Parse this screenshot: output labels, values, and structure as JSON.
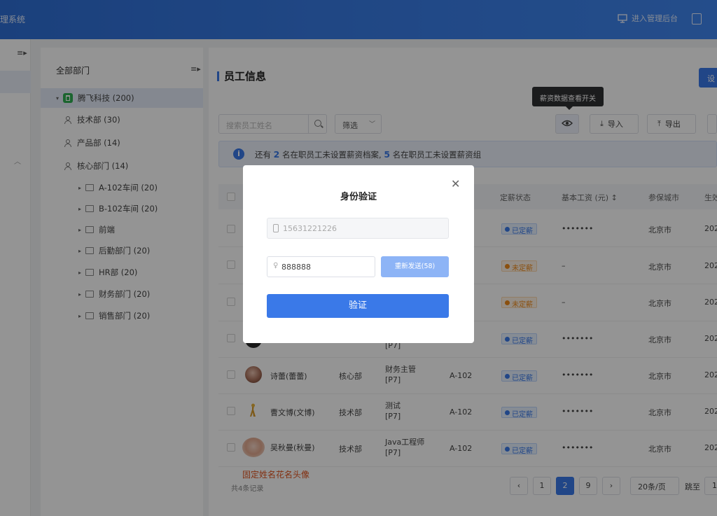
{
  "header": {
    "brand": "理系统",
    "admin_label": "进入管理后台"
  },
  "tree": {
    "title": "全部部门",
    "items": [
      {
        "label": "腾飞科技 (200)",
        "active": true
      },
      {
        "label": "技术部 (30)"
      },
      {
        "label": "产品部 (14)"
      },
      {
        "label": "核心部门 (14)"
      },
      {
        "label": "A-102车间 (20)"
      },
      {
        "label": "B-102车间 (20)"
      },
      {
        "label": "前端"
      },
      {
        "label": "后勤部门 (20)"
      },
      {
        "label": "HR部 (20)"
      },
      {
        "label": "财务部门 (20)"
      },
      {
        "label": "销售部门 (20)"
      }
    ]
  },
  "main": {
    "title": "员工信息",
    "settings_label": "设",
    "search_placeholder": "搜索员工姓名",
    "filter_label": "筛选",
    "tooltip": "薪资数据查看开关",
    "import_label": "导入",
    "export_label": "导出",
    "notice": {
      "prefix": "还有",
      "count1": "2",
      "mid": "名在职员工未设置薪资档案,",
      "count2": "5",
      "suffix": "名在职员工未设置薪资组"
    },
    "columns": [
      "定薪状态",
      "基本工资 (元) ↕",
      "参保城市",
      "生效"
    ],
    "rows": [
      {
        "name": "",
        "dept": "",
        "position": "",
        "level": "",
        "location": "",
        "status": "已定薪",
        "status_type": "ok",
        "salary": "•••••••",
        "city": "北京市",
        "date": "202"
      },
      {
        "name": "",
        "dept": "",
        "position": "",
        "level": "",
        "location": "",
        "status": "未定薪",
        "status_type": "no",
        "salary": "–",
        "city": "北京市",
        "date": "202"
      },
      {
        "name": "",
        "dept": "",
        "position": "",
        "level": "",
        "location": "",
        "status": "未定薪",
        "status_type": "no",
        "salary": "–",
        "city": "北京市",
        "date": "202"
      },
      {
        "name": "",
        "dept": "",
        "position": "",
        "level": "[P7]",
        "location": "",
        "status": "已定薪",
        "status_type": "ok",
        "salary": "•••••••",
        "city": "北京市",
        "date": "202"
      },
      {
        "name": "诗蕾(蕾蕾)",
        "dept": "核心部",
        "position": "财务主管",
        "level": "[P7]",
        "location": "A-102",
        "status": "已定薪",
        "status_type": "ok",
        "salary": "•••••••",
        "city": "北京市",
        "date": "202"
      },
      {
        "name": "曹文博(文博)",
        "dept": "技术部",
        "position": "测试",
        "level": "[P7]",
        "location": "A-102",
        "status": "已定薪",
        "status_type": "ok",
        "salary": "•••••••",
        "city": "北京市",
        "date": "202"
      },
      {
        "name": "吴秋曼(秋曼)",
        "dept": "技术部",
        "position": "Java工程师",
        "level": "[P7]",
        "location": "A-102",
        "status": "已定薪",
        "status_type": "ok",
        "salary": "•••••••",
        "city": "北京市",
        "date": "202"
      }
    ],
    "annotation": "固定姓名花名头像",
    "total": "共4条记录",
    "pagination": {
      "prev": "‹",
      "pages": [
        "1",
        "2",
        "9"
      ],
      "current": "2",
      "next": "›",
      "page_size": "20条/页",
      "jump_label": "跳至",
      "jump_value": "1"
    }
  },
  "modal": {
    "title": "身份验证",
    "phone": "15631221226",
    "code": "888888",
    "resend": "重新发送(58)",
    "verify": "验证"
  }
}
